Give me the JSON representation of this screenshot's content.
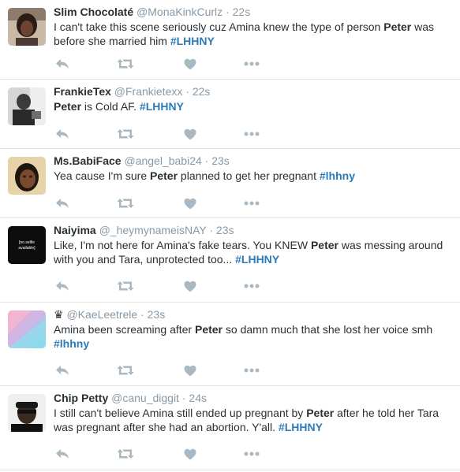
{
  "colors": {
    "hashtag": "#2b7bb9",
    "meta": "#8899a6",
    "icon": "#aab8c2",
    "divider": "#e1e8ed"
  },
  "tweets": [
    {
      "fullname": "Slim Chocolaté",
      "username": "@MonaKinkCurlz",
      "dot": "·",
      "time": "22s",
      "text": [
        {
          "t": "I can't take this scene seriously cuz Amina knew the type of person "
        },
        {
          "t": "Peter",
          "b": true
        },
        {
          "t": " was before she married him "
        },
        {
          "t": "#LHHNY",
          "h": true
        }
      ]
    },
    {
      "fullname": "FrankieTex",
      "username": "@Frankietexx",
      "dot": "·",
      "time": "22s",
      "text": [
        {
          "t": "Peter",
          "b": true
        },
        {
          "t": " is Cold AF. "
        },
        {
          "t": "#LHHNY",
          "h": true
        }
      ]
    },
    {
      "fullname": "Ms.BabiFace",
      "username": "@angel_babi24",
      "dot": "·",
      "time": "23s",
      "text": [
        {
          "t": "Yea cause I'm sure "
        },
        {
          "t": "Peter",
          "b": true
        },
        {
          "t": " planned to get her pregnant "
        },
        {
          "t": "#lhhny",
          "h": true
        }
      ]
    },
    {
      "fullname": "Naiyima",
      "username": "@_heymynameisNAY",
      "dot": "·",
      "time": "23s",
      "avatar_text": "[no selfie available]",
      "text": [
        {
          "t": "Like, I'm not here for Amina's fake tears. You KNEW "
        },
        {
          "t": "Peter",
          "b": true
        },
        {
          "t": " was messing around with you and Tara, unprotected too... "
        },
        {
          "t": "#LHHNY",
          "h": true
        }
      ]
    },
    {
      "fullname": "♛",
      "username": "@KaeLeetrele",
      "dot": "·",
      "time": "23s",
      "text": [
        {
          "t": "Amina been screaming after "
        },
        {
          "t": "Peter",
          "b": true
        },
        {
          "t": " so damn much that she lost her voice smh "
        },
        {
          "t": "#lhhny",
          "h": true
        }
      ]
    },
    {
      "fullname": "Chip Petty",
      "username": "@canu_diggit",
      "dot": "·",
      "time": "24s",
      "text": [
        {
          "t": "I still can't believe Amina still ended up pregnant by "
        },
        {
          "t": "Peter",
          "b": true
        },
        {
          "t": " after he told her Tara was pregnant after she had an abortion. Y'all. "
        },
        {
          "t": "#LHHNY",
          "h": true
        }
      ]
    }
  ]
}
